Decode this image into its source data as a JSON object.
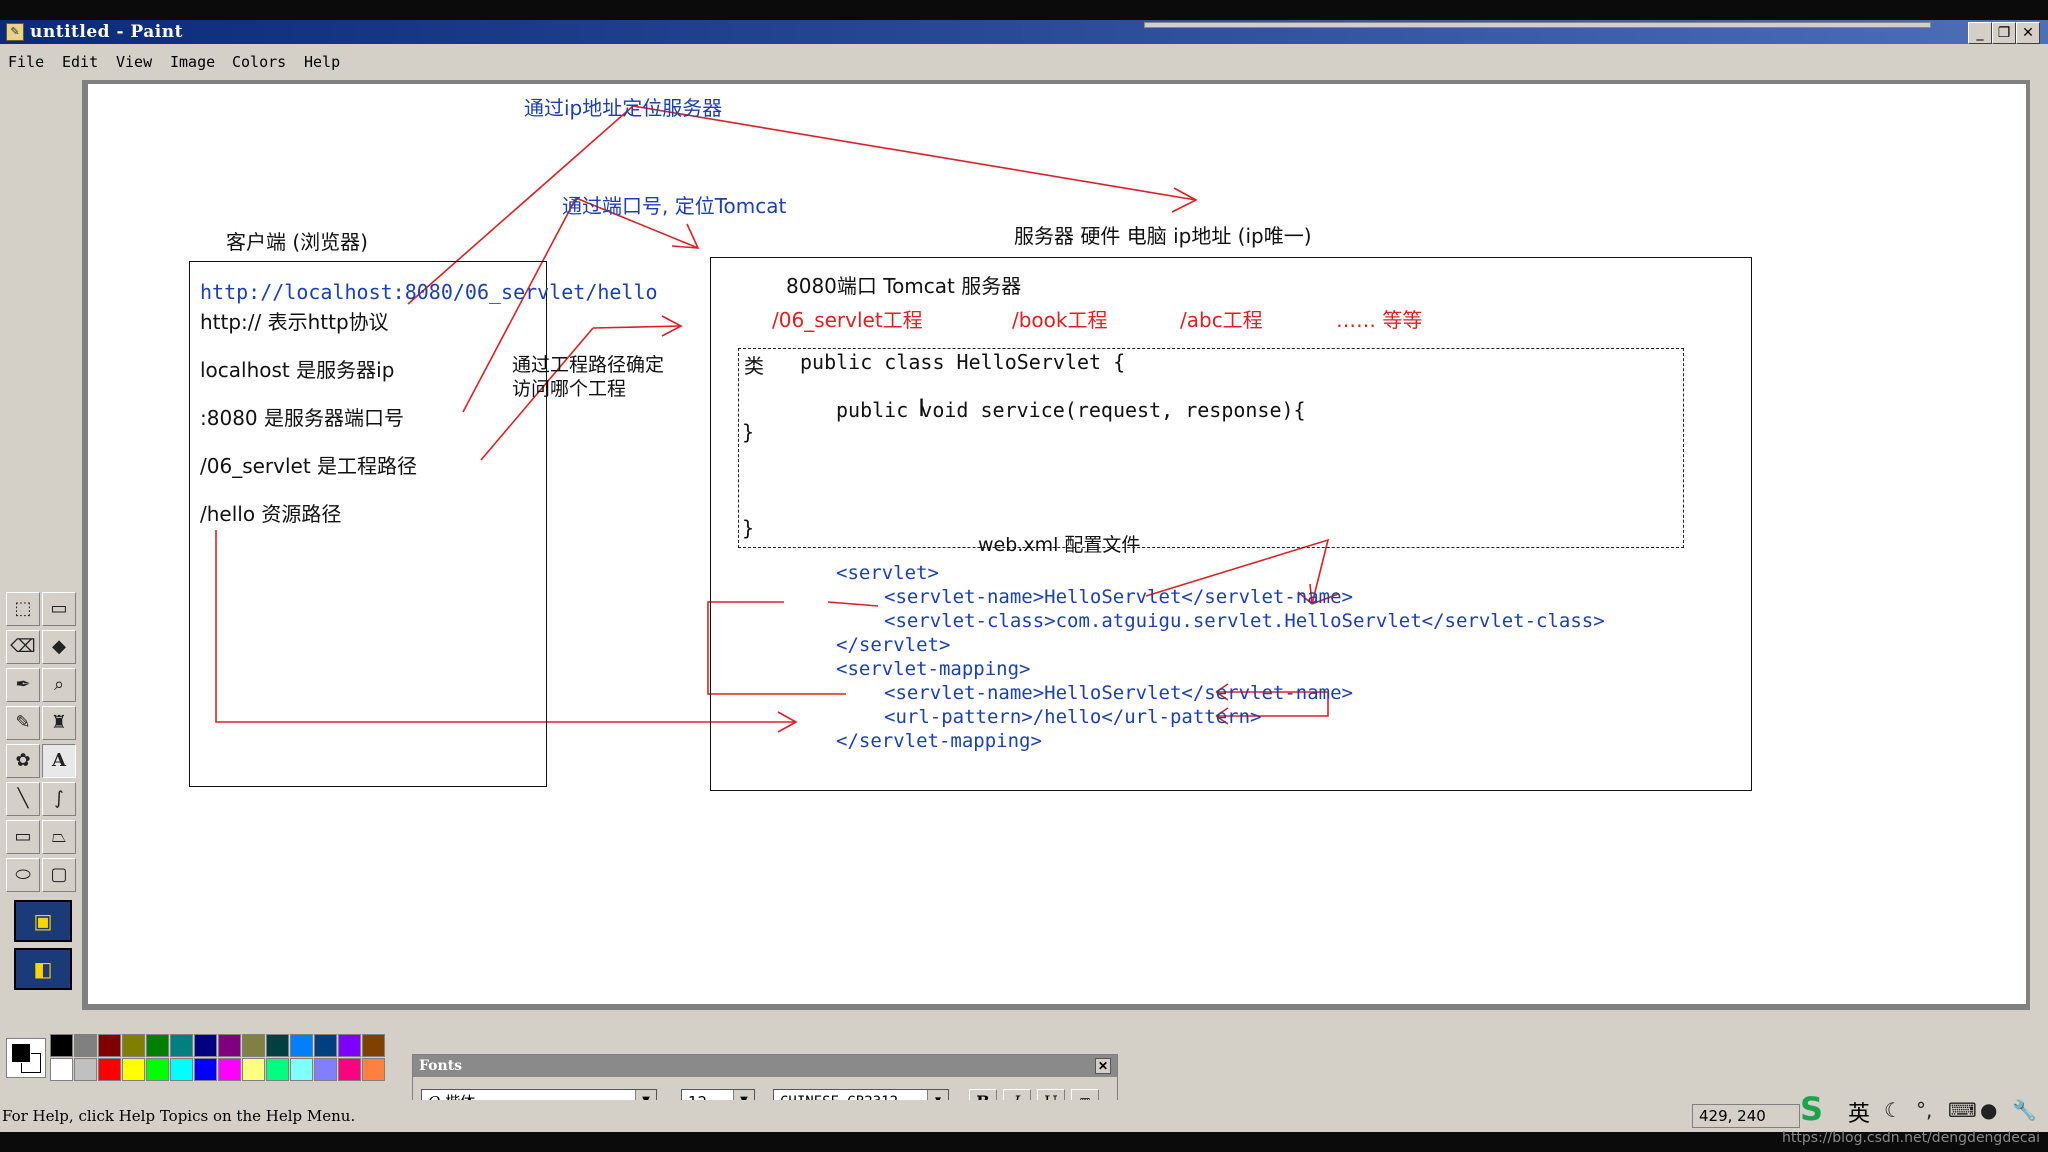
{
  "window": {
    "title": "untitled - Paint"
  },
  "menu": [
    "File",
    "Edit",
    "View",
    "Image",
    "Colors",
    "Help"
  ],
  "canvas": {
    "annotations": {
      "ip_locate": "通过ip地址定位服务器",
      "port_locate": "通过端口号, 定位Tomcat",
      "project_path_line1": "通过工程路径确定",
      "project_path_line2": "访问哪个工程"
    },
    "client": {
      "heading": "客户端 (浏览器)",
      "url": "http://localhost:8080/06_servlet/hello",
      "lines": [
        "http:// 表示http协议",
        "localhost 是服务器ip",
        ":8080 是服务器端口号",
        "/06_servlet 是工程路径",
        "/hello  资源路径"
      ]
    },
    "server": {
      "heading": "服务器 硬件 电脑  ip地址 (ip唯一)",
      "tomcat_label": "8080端口 Tomcat 服务器",
      "projects": [
        "/06_servlet工程",
        "/book工程",
        "/abc工程",
        "…… 等等"
      ],
      "class_tag": "类",
      "class_decl": "public class HelloServlet {",
      "method_decl": "public void service(request, response){",
      "brace_inner": "}",
      "brace_outer": "}",
      "webxml_label": "web.xml 配置文件",
      "xml_lines": [
        "<servlet>",
        "<servlet-name>HelloServlet</servlet-name>",
        "<servlet-class>com.atguigu.servlet.HelloServlet</servlet-class>",
        "</servlet>",
        "<servlet-mapping>",
        "<servlet-name>HelloServlet</servlet-name>",
        "<url-pattern>/hello</url-pattern>",
        "</servlet-mapping>"
      ]
    }
  },
  "fonts_toolbar": {
    "title": "Fonts",
    "font_name": "楷体",
    "font_size": "12",
    "script": "CHINESE_GB2312",
    "bold": "B",
    "italic": "I",
    "underline": "U"
  },
  "status": {
    "help": "For Help, click Help Topics on the Help Menu.",
    "coords": "429, 240"
  },
  "tray": {
    "ime_language": "英"
  },
  "watermark": "https://blog.csdn.net/dengdengdecai",
  "palette": {
    "top": [
      "#000000",
      "#808080",
      "#800000",
      "#808000",
      "#008000",
      "#008080",
      "#000080",
      "#800080",
      "#808040",
      "#004040",
      "#0080ff",
      "#004080",
      "#8000ff",
      "#804000"
    ],
    "bottom": [
      "#ffffff",
      "#c0c0c0",
      "#ff0000",
      "#ffff00",
      "#00ff00",
      "#00ffff",
      "#0000ff",
      "#ff00ff",
      "#ffff80",
      "#00ff80",
      "#80ffff",
      "#8080ff",
      "#ff0080",
      "#ff8040"
    ]
  }
}
